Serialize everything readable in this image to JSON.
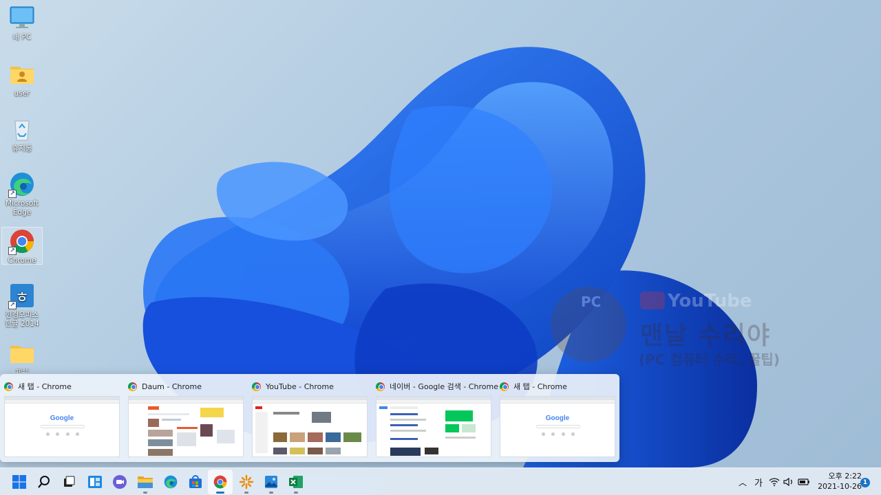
{
  "desktop": {
    "icons": [
      {
        "label": "내 PC",
        "icon": "monitor-icon"
      },
      {
        "label": "user",
        "icon": "user-folder-icon"
      },
      {
        "label": "휴지통",
        "icon": "recycle-bin-icon"
      },
      {
        "label": "Microsoft Edge",
        "icon": "edge-icon"
      },
      {
        "label": "Chrome",
        "icon": "chrome-icon",
        "selected": true
      },
      {
        "label": "한컴오피스 한글 2014",
        "icon": "hancom-hangul-icon"
      },
      {
        "label": "제쉐",
        "icon": "folder-icon"
      }
    ]
  },
  "watermark": {
    "badge": "PC",
    "youtube": "YouTube",
    "title": "맨날 수리야",
    "subtitle": "(PC 컴퓨터 수리, 꿀팁)"
  },
  "preview": {
    "thumbnails": [
      {
        "title": "새 탭 - Chrome",
        "page": "google"
      },
      {
        "title": "Daum - Chrome",
        "page": "daum"
      },
      {
        "title": "YouTube - Chrome",
        "page": "youtube"
      },
      {
        "title": "네이버 - Google 검색 - Chrome",
        "page": "google-search"
      },
      {
        "title": "새 탭 - Chrome",
        "page": "google"
      }
    ],
    "google_logo": "Google"
  },
  "taskbar": {
    "apps": [
      {
        "name": "start",
        "icon": "windows-start-icon"
      },
      {
        "name": "search",
        "icon": "search-icon"
      },
      {
        "name": "task-view",
        "icon": "task-view-icon"
      },
      {
        "name": "widgets",
        "icon": "widgets-icon"
      },
      {
        "name": "teams-chat",
        "icon": "teams-chat-icon"
      },
      {
        "name": "file-explorer",
        "icon": "file-explorer-icon",
        "running": true
      },
      {
        "name": "edge",
        "icon": "edge-icon"
      },
      {
        "name": "microsoft-store",
        "icon": "store-icon"
      },
      {
        "name": "chrome",
        "icon": "chrome-icon",
        "running": true,
        "active": true
      },
      {
        "name": "app-orange",
        "icon": "sparkle-app-icon",
        "running": true
      },
      {
        "name": "photos",
        "icon": "photos-icon",
        "running": true
      },
      {
        "name": "excel",
        "icon": "excel-icon",
        "running": true
      }
    ],
    "tray": {
      "ime": "가",
      "time": "오후 2:22",
      "date": "2021-10-26",
      "notification_count": "1"
    }
  },
  "colors": {
    "accent": "#1a73c8",
    "wallpaper_bloom": "#1e63e6"
  }
}
